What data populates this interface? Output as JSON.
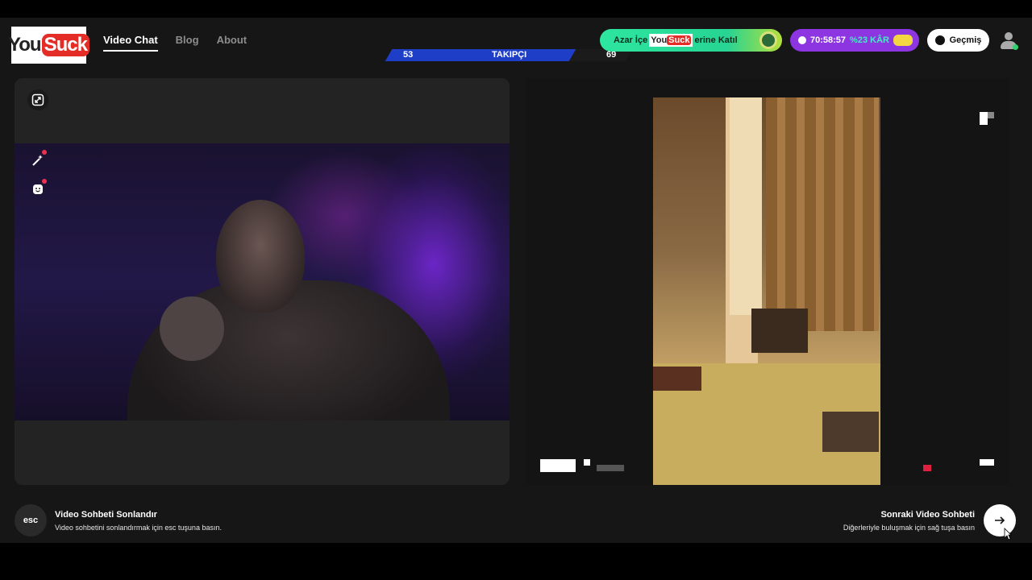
{
  "header": {
    "logo": {
      "part1": "You",
      "part2": "Suck"
    },
    "nav": [
      {
        "label": "Video Chat",
        "active": true
      },
      {
        "label": "Blog",
        "active": false
      },
      {
        "label": "About",
        "active": false
      }
    ],
    "follow_bar": {
      "left_count": "53",
      "label": "TAKIPÇI",
      "right_count": "69"
    },
    "join_pill": {
      "text_before": "Azar İçe",
      "logo_part1": "You",
      "logo_part2": "Suck",
      "text_after": "erine Katıl"
    },
    "timer_pill": {
      "time": "70:58:57",
      "profit": "%23 KÂR",
      "icon": "clock-icon"
    },
    "history_button": {
      "label": "Geçmiş",
      "icon": "clock-icon"
    },
    "user": {
      "icon": "user-avatar-icon",
      "status_color": "#2cd36e"
    }
  },
  "tools": [
    {
      "name": "expand-icon"
    },
    {
      "name": "magic-wand-icon",
      "notify": true
    },
    {
      "name": "face-filter-icon",
      "notify": true
    }
  ],
  "footer": {
    "esc_key": "esc",
    "end_title": "Video Sohbeti Sonlandır",
    "end_subtitle": "Video sohbetini sonlandırmak için esc tuşuna basın.",
    "next_title": "Sonraki Video Sohbeti",
    "next_subtitle": "Diğerleriyle buluşmak için sağ tuşa basın"
  },
  "colors": {
    "background": "#161616",
    "panel": "#232323",
    "follow_bar": "#1e3ec8",
    "join_pill": "#2de6a0",
    "timer_pill": "#8c35e0",
    "profit_text": "#49e9c9",
    "notify_dot": "#ee3050",
    "logo_red": "#e52d27"
  }
}
